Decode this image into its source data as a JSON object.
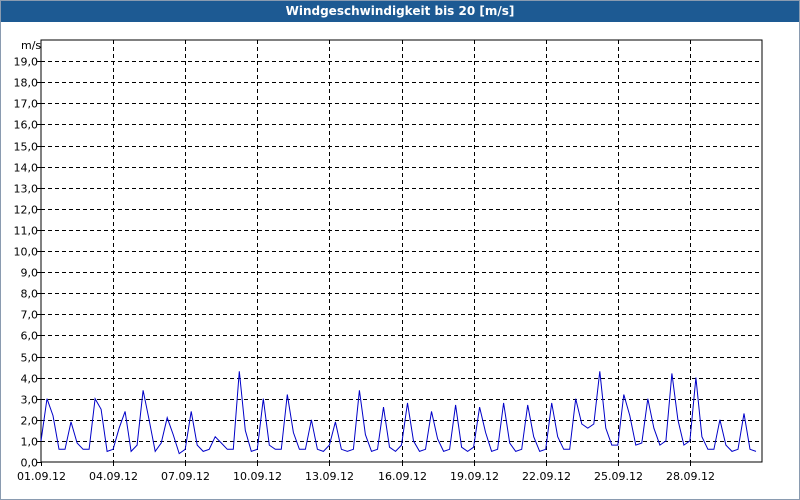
{
  "window": {
    "title": "Windgeschwindigkeit bis 20 [m/s]"
  },
  "colors": {
    "titlebar": "#1d5a93",
    "series": "#0000c8",
    "grid": "#000000"
  },
  "chart_data": {
    "type": "line",
    "title": "Windgeschwindigkeit bis 20 [m/s]",
    "unit_label": "m/s",
    "ylim": [
      0,
      20
    ],
    "xlim": [
      "2012-09-01T00:00",
      "2012-10-01T00:00"
    ],
    "yticks": [
      "0,0",
      "1,0",
      "2,0",
      "3,0",
      "4,0",
      "5,0",
      "6,0",
      "7,0",
      "8,0",
      "9,0",
      "10,0",
      "11,0",
      "12,0",
      "13,0",
      "14,0",
      "15,0",
      "16,0",
      "17,0",
      "18,0",
      "19,0"
    ],
    "xticks": [
      "01.09.12",
      "04.09.12",
      "07.09.12",
      "10.09.12",
      "13.09.12",
      "16.09.12",
      "19.09.12",
      "22.09.12",
      "25.09.12",
      "28.09.12"
    ],
    "grid": true,
    "series": [
      {
        "name": "",
        "x": [
          "2012-09-01T00:00",
          "2012-09-01T06:00",
          "2012-09-01T12:00",
          "2012-09-01T18:00",
          "2012-09-02T00:00",
          "2012-09-02T06:00",
          "2012-09-02T12:00",
          "2012-09-02T18:00",
          "2012-09-03T00:00",
          "2012-09-03T06:00",
          "2012-09-03T12:00",
          "2012-09-03T18:00",
          "2012-09-04T00:00",
          "2012-09-04T06:00",
          "2012-09-04T12:00",
          "2012-09-04T18:00",
          "2012-09-05T00:00",
          "2012-09-05T06:00",
          "2012-09-05T12:00",
          "2012-09-05T18:00",
          "2012-09-06T00:00",
          "2012-09-06T06:00",
          "2012-09-06T12:00",
          "2012-09-06T18:00",
          "2012-09-07T00:00",
          "2012-09-07T06:00",
          "2012-09-07T12:00",
          "2012-09-07T18:00",
          "2012-09-08T00:00",
          "2012-09-08T06:00",
          "2012-09-08T12:00",
          "2012-09-08T18:00",
          "2012-09-09T00:00",
          "2012-09-09T06:00",
          "2012-09-09T12:00",
          "2012-09-09T18:00",
          "2012-09-10T00:00",
          "2012-09-10T06:00",
          "2012-09-10T12:00",
          "2012-09-10T18:00",
          "2012-09-11T00:00",
          "2012-09-11T06:00",
          "2012-09-11T12:00",
          "2012-09-11T18:00",
          "2012-09-12T00:00",
          "2012-09-12T06:00",
          "2012-09-12T12:00",
          "2012-09-12T18:00",
          "2012-09-13T00:00",
          "2012-09-13T06:00",
          "2012-09-13T12:00",
          "2012-09-13T18:00",
          "2012-09-14T00:00",
          "2012-09-14T06:00",
          "2012-09-14T12:00",
          "2012-09-14T18:00",
          "2012-09-15T00:00",
          "2012-09-15T06:00",
          "2012-09-15T12:00",
          "2012-09-15T18:00",
          "2012-09-16T00:00",
          "2012-09-16T06:00",
          "2012-09-16T12:00",
          "2012-09-16T18:00",
          "2012-09-17T00:00",
          "2012-09-17T06:00",
          "2012-09-17T12:00",
          "2012-09-17T18:00",
          "2012-09-18T00:00",
          "2012-09-18T06:00",
          "2012-09-18T12:00",
          "2012-09-18T18:00",
          "2012-09-19T00:00",
          "2012-09-19T06:00",
          "2012-09-19T12:00",
          "2012-09-19T18:00",
          "2012-09-20T00:00",
          "2012-09-20T06:00",
          "2012-09-20T12:00",
          "2012-09-20T18:00",
          "2012-09-21T00:00",
          "2012-09-21T06:00",
          "2012-09-21T12:00",
          "2012-09-21T18:00",
          "2012-09-22T00:00",
          "2012-09-22T06:00",
          "2012-09-22T12:00",
          "2012-09-22T18:00",
          "2012-09-23T00:00",
          "2012-09-23T06:00",
          "2012-09-23T12:00",
          "2012-09-23T18:00",
          "2012-09-24T00:00",
          "2012-09-24T06:00",
          "2012-09-24T12:00",
          "2012-09-24T18:00",
          "2012-09-25T00:00",
          "2012-09-25T06:00",
          "2012-09-25T12:00",
          "2012-09-25T18:00",
          "2012-09-26T00:00",
          "2012-09-26T06:00",
          "2012-09-26T12:00",
          "2012-09-26T18:00",
          "2012-09-27T00:00",
          "2012-09-27T06:00",
          "2012-09-27T12:00",
          "2012-09-27T18:00",
          "2012-09-28T00:00",
          "2012-09-28T06:00",
          "2012-09-28T12:00",
          "2012-09-28T18:00",
          "2012-09-29T00:00",
          "2012-09-29T06:00",
          "2012-09-29T12:00",
          "2012-09-29T18:00",
          "2012-09-30T00:00",
          "2012-09-30T06:00",
          "2012-09-30T12:00",
          "2012-09-30T18:00"
        ],
        "y": [
          1.0,
          3.0,
          2.2,
          0.6,
          0.6,
          1.9,
          0.9,
          0.6,
          0.6,
          3.0,
          2.5,
          0.5,
          0.6,
          1.6,
          2.4,
          0.5,
          0.8,
          3.4,
          2.0,
          0.5,
          0.9,
          2.1,
          1.3,
          0.4,
          0.6,
          2.4,
          0.8,
          0.5,
          0.6,
          1.2,
          0.9,
          0.6,
          0.6,
          4.3,
          1.5,
          0.5,
          0.6,
          3.0,
          0.8,
          0.6,
          0.6,
          3.2,
          1.4,
          0.6,
          0.6,
          2.0,
          0.6,
          0.5,
          0.8,
          1.9,
          0.6,
          0.5,
          0.6,
          3.4,
          1.3,
          0.5,
          0.6,
          2.6,
          0.7,
          0.5,
          0.8,
          2.8,
          1.0,
          0.5,
          0.6,
          2.4,
          1.1,
          0.5,
          0.6,
          2.7,
          0.7,
          0.5,
          0.7,
          2.6,
          1.4,
          0.5,
          0.6,
          2.8,
          0.9,
          0.5,
          0.6,
          2.7,
          1.2,
          0.5,
          0.6,
          2.8,
          1.2,
          0.6,
          0.6,
          3.0,
          1.8,
          1.6,
          1.8,
          4.3,
          1.6,
          0.8,
          0.8,
          3.2,
          2.2,
          0.8,
          0.9,
          3.0,
          1.6,
          0.8,
          1.0,
          4.2,
          2.0,
          0.8,
          1.0,
          4.0,
          1.2,
          0.6,
          0.6,
          2.0,
          0.8,
          0.5,
          0.6,
          2.3,
          0.6,
          0.5
        ]
      }
    ]
  }
}
